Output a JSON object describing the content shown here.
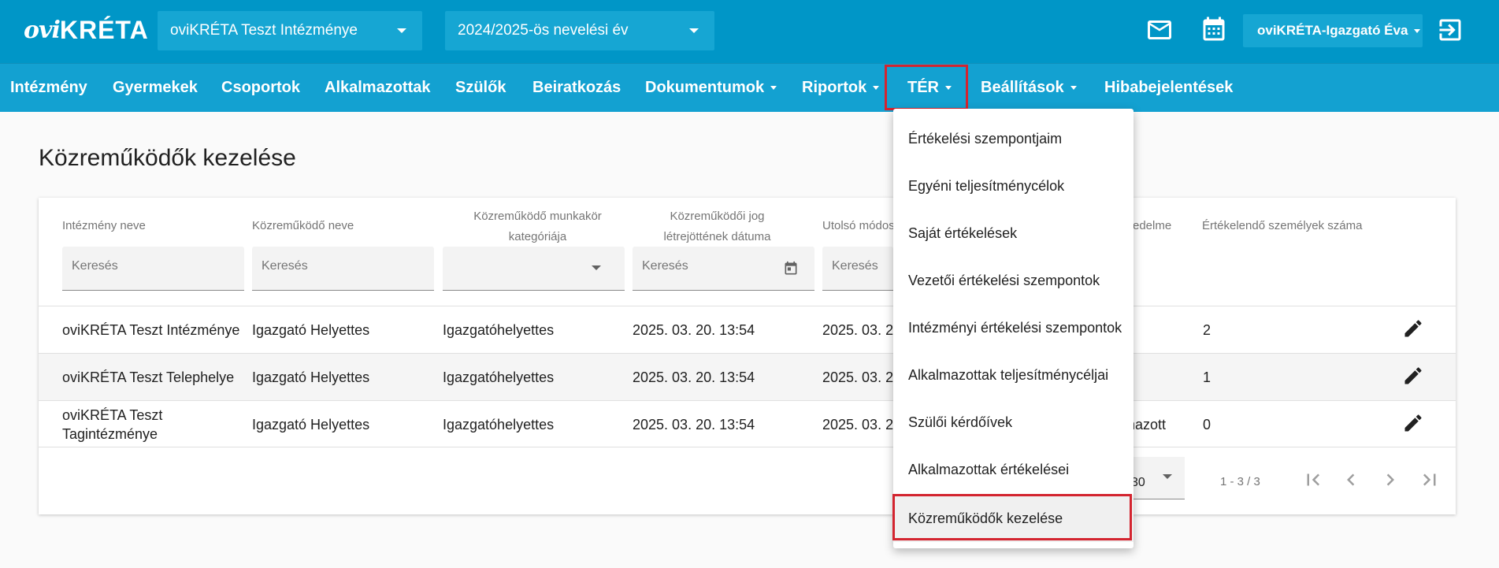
{
  "header": {
    "logo_ovi": "ovi",
    "logo_kreta": "KRÉTA",
    "institution_select": "oviKRÉTA Teszt Intézménye",
    "year_select": "2024/2025-ös nevelési év",
    "user": "oviKRÉTA-Igazgató Éva",
    "icons": [
      "mail-icon",
      "calendar-icon",
      "logout-icon"
    ],
    "brand_color": "#0096c7"
  },
  "nav": {
    "items": [
      {
        "label": "Intézmény",
        "has_menu": false
      },
      {
        "label": "Gyermekek",
        "has_menu": false
      },
      {
        "label": "Csoportok",
        "has_menu": false
      },
      {
        "label": "Alkalmazottak",
        "has_menu": false
      },
      {
        "label": "Szülők",
        "has_menu": false
      },
      {
        "label": "Beiratkozás",
        "has_menu": false
      },
      {
        "label": "Dokumentumok",
        "has_menu": true
      },
      {
        "label": "Riportok",
        "has_menu": true
      },
      {
        "label": "TÉR",
        "has_menu": true,
        "active": true
      },
      {
        "label": "Beállítások",
        "has_menu": true
      },
      {
        "label": "Hibabejelentések",
        "has_menu": false
      }
    ],
    "highlight_color": "#d3242f"
  },
  "page": {
    "title": "Közreműködők kezelése"
  },
  "table": {
    "headers": [
      "Intézmény neve",
      "Közreműködő neve",
      "Közreműködő munkakör kategóriája",
      "Közreműködői jog létrejöttének dátuma",
      "Utolsó módos",
      "edelme",
      "Értékelendő személyek száma"
    ],
    "filters": {
      "placeholder": "Keresés"
    },
    "rows": [
      {
        "intezmeny": "oviKRÉTA Teszt Intézménye",
        "nev": "Igazgató Helyettes",
        "kategoria": "Igazgatóhelyettes",
        "datum": "2025. 03. 20. 13:54",
        "utolso": "2025. 03. 2",
        "extra": "",
        "szam": "2"
      },
      {
        "intezmeny": "oviKRÉTA Teszt Telephelye",
        "nev": "Igazgató Helyettes",
        "kategoria": "Igazgatóhelyettes",
        "datum": "2025. 03. 20. 13:54",
        "utolso": "2025. 03. 2",
        "extra": "",
        "szam": "1"
      },
      {
        "intezmeny": "oviKRÉTA Teszt Tagintézménye",
        "nev": "Igazgató Helyettes",
        "kategoria": "Igazgatóhelyettes",
        "datum": "2025. 03. 20. 13:54",
        "utolso": "2025. 03. 2",
        "extra": "nazott",
        "szam": "0"
      }
    ],
    "pager": {
      "page_size_partial": "30",
      "range": "1 - 3 / 3"
    }
  },
  "menu": {
    "items": [
      "Értékelési szempontjaim",
      "Egyéni teljesítménycélok",
      "Saját értékelések",
      "Vezetői értékelési szempontok",
      "Intézményi értékelési szempontok",
      "Alkalmazottak teljesítménycéljai",
      "Szülői kérdőívek",
      "Alkalmazottak értékelései",
      "Közreműködők kezelése"
    ],
    "active_index": 8
  }
}
